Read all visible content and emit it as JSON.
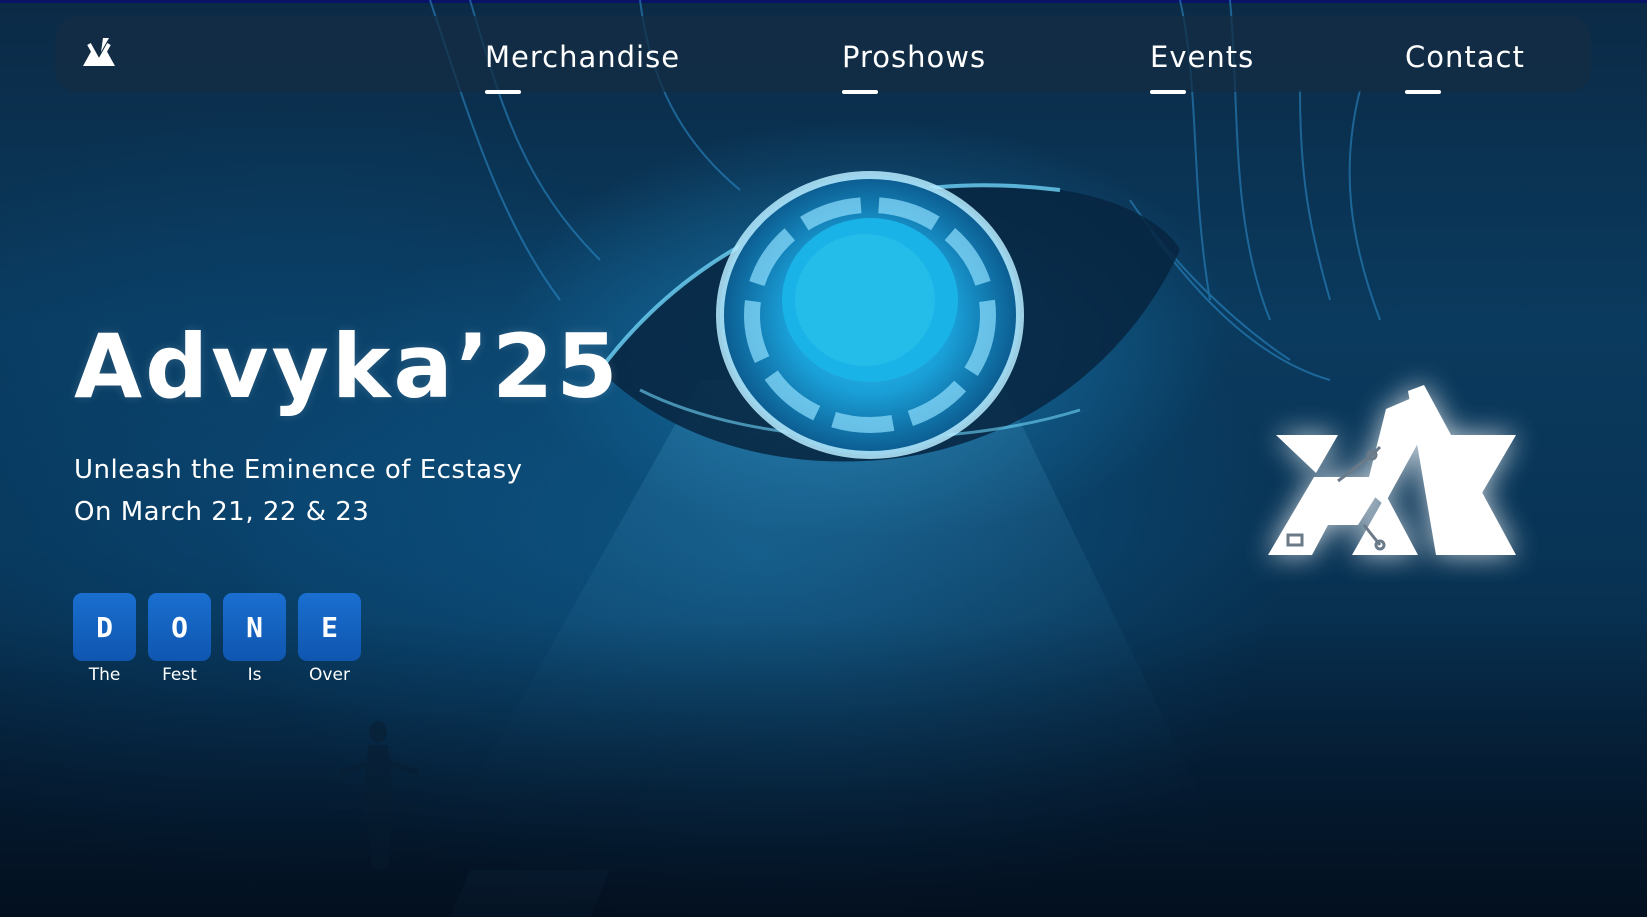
{
  "nav": {
    "items": [
      {
        "label": "Merchandise"
      },
      {
        "label": "Proshows"
      },
      {
        "label": "Events"
      },
      {
        "label": "Contact"
      }
    ]
  },
  "hero": {
    "title": "Advyka’25",
    "tagline": "Unleash the Eminence of Ecstasy",
    "dates": "On March 21, 22 & 23"
  },
  "countdown": [
    {
      "letter": "D",
      "caption": "The"
    },
    {
      "letter": "O",
      "caption": "Fest"
    },
    {
      "letter": "N",
      "caption": "Is"
    },
    {
      "letter": "E",
      "caption": "Over"
    }
  ],
  "colors": {
    "tile": "#1565c0",
    "text": "#ffffff",
    "background": "#0a3a5e"
  },
  "icons": {
    "nav_logo": "advyka-logo-icon",
    "hero_logo": "advyka-logo-icon"
  }
}
